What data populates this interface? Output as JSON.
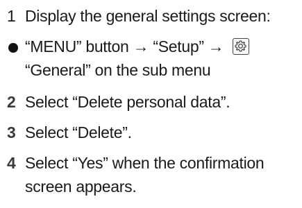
{
  "steps": [
    {
      "number": "1",
      "text": "Display the general settings screen:"
    },
    {
      "bullet_line1": "“MENU” button → “Setup” →",
      "bullet_line2": "“General” on the sub menu",
      "icon": "gear-icon"
    },
    {
      "number": "2",
      "text": "Select “Delete personal data”."
    },
    {
      "number": "3",
      "text": "Select “Delete”."
    },
    {
      "number": "4",
      "text": "Select “Yes” when the confirmation",
      "text_line2": "screen appears."
    }
  ]
}
